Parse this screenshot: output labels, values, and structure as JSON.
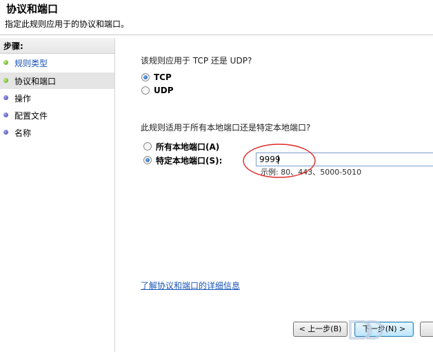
{
  "header": {
    "title": "协议和端口",
    "description": "指定此规则应用于的协议和端口。"
  },
  "steps": {
    "title": "步骤:",
    "items": [
      {
        "label": "规则类型",
        "state": "done"
      },
      {
        "label": "协议和端口",
        "state": "current"
      },
      {
        "label": "操作",
        "state": "todo"
      },
      {
        "label": "配置文件",
        "state": "todo"
      },
      {
        "label": "名称",
        "state": "todo"
      }
    ]
  },
  "protocol": {
    "question": "该规则应用于 TCP 还是 UDP?",
    "options": [
      {
        "label": "TCP",
        "selected": true
      },
      {
        "label": "UDP",
        "selected": false
      }
    ]
  },
  "ports": {
    "question": "此规则适用于所有本地端口还是特定本地端口?",
    "all_label": "所有本地端口(A)",
    "specific_label": "特定本地端口(S):",
    "selected": "specific",
    "value": "9999",
    "example": "示例: 80、443、5000-5010"
  },
  "learn_more": "了解协议和端口的详细信息",
  "buttons": {
    "back": "< 上一步(B)",
    "next": "下一步(N) >"
  },
  "colors": {
    "link": "#1a55b5",
    "annotation": "#e02424",
    "current_step_bg": "#e5e5e5"
  }
}
